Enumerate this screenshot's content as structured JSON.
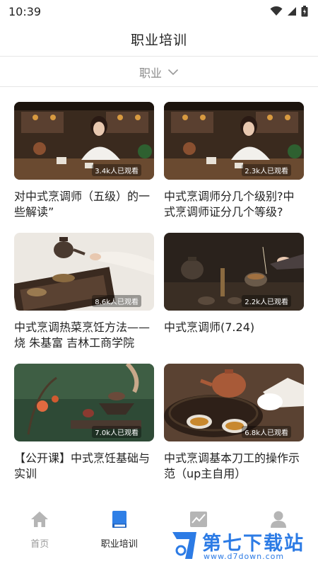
{
  "status_bar": {
    "time": "10:39"
  },
  "header": {
    "title": "职业培训"
  },
  "filter": {
    "label": "职业"
  },
  "courses": [
    {
      "title": "对中式烹调师（五级）的一些解读”",
      "views": "3.4k人已观看",
      "scene": "tea-woman"
    },
    {
      "title": "中式烹调师分几个级别?中式烹调师证分几个等级?",
      "views": "2.3k人已观看",
      "scene": "tea-woman"
    },
    {
      "title": "中式烹调热菜烹饪方法——烧 朱基富 吉林工商学院",
      "views": "8.6k人已观看",
      "scene": "teapot-pour"
    },
    {
      "title": "中式烹调师(7.24)",
      "views": "2.2k人已观看",
      "scene": "dark-tea-set"
    },
    {
      "title": "【公开课】中式烹饪基础与实训",
      "views": "7.0k人已观看",
      "scene": "green-bowl"
    },
    {
      "title": "中式烹调基本刀工的操作示范（up主自用）",
      "views": "6.8k人已观看",
      "scene": "clay-teapot"
    }
  ],
  "tabs": [
    {
      "label": "首页",
      "icon": "home-icon",
      "active": false
    },
    {
      "label": "职业培训",
      "icon": "book-icon",
      "active": true
    },
    {
      "label": "",
      "icon": "chart-icon",
      "active": false
    },
    {
      "label": "",
      "icon": "user-icon",
      "active": false
    }
  ],
  "watermark": {
    "title": "第七下载站",
    "url": "www.d7down.com"
  },
  "colors": {
    "accent": "#2c7be5",
    "active_icon": "#2f7fe6",
    "inactive_icon": "#b5b5b5"
  }
}
